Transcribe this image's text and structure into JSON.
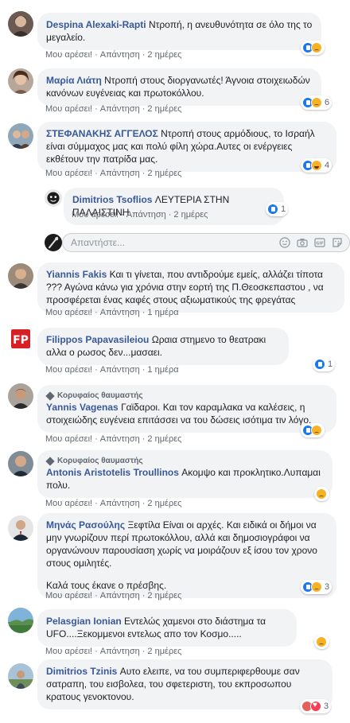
{
  "action_labels": {
    "like": "Μου αρέσει!",
    "reply": "Απάντηση",
    "separator": "·"
  },
  "top_fan_badge": "Κορυφαίος θαυμαστής",
  "reply_box": {
    "placeholder": "Απαντήστε..."
  },
  "comments": [
    {
      "author": "Despina Alexaki-Rapti",
      "text": "Ντροπή, η ανευθυνότητα σε όλο της το μεγαλείο.",
      "time": "2 ημέρες",
      "reactions": [
        "like",
        "sad"
      ],
      "count": ""
    },
    {
      "author": "Μαρία Λιάτη",
      "text": "Ντροπή στους διοργανωτές! Άγνοια στοιχειωδών κανόνων ευγένειας και πρωτοκόλλου.",
      "time": "2 ημέρες",
      "reactions": [
        "like",
        "sad"
      ],
      "count": "6"
    },
    {
      "author": "ΣΤΕΦΑΝΑΚΗΣ ΑΓΓΕΛΟΣ",
      "text": "Ντροπή στους αρμόδιους, το Ισραήλ είναι σύμμαχος μας και πολύ φίλη χώρα.Αυτες οι ενέργειες εκθέτουν την πατρίδα μας.",
      "time": "2 ημέρες",
      "reactions": [
        "like",
        "haha"
      ],
      "count": "4"
    },
    {
      "author": "Dimitrios Tsoflios",
      "text": "ΛΕΥΤΕΡΙΑ ΣΤΗΝ ΠΑΛΑΙΣΤΙΝΗ",
      "time": "2 ημέρες",
      "reactions": [
        "like"
      ],
      "count": "1"
    },
    {
      "author": "Yiannis Fakis",
      "text": "Και τι γίνεται, που αντιδρούμε εμείς, αλλάζει τίποτα ??? Αγώνα κάνω για χρόνια στην εορτή της Π.Θεοσκεπαστου , να προσφέρεται ένας καφές στους αξιωματικούς της φρεγάτας",
      "time": "1 ημέρα",
      "reactions": [],
      "count": ""
    },
    {
      "author": "Filippos Papavasileiou",
      "text": "Ωραια στημενο το θεατρακι αλλα ο ρωσος δεν...μασαει.",
      "time": "1 ημέρα",
      "reactions": [
        "like"
      ],
      "count": "1"
    },
    {
      "author": "Yannis Vagenas",
      "text": "Γαϊδαροι. Και τον καραμλακα να καλέσεις, η στοιχειώδης ευγένεια επιτάσσει να του δώσεις ισότιμα τιν λόγο.",
      "time": "2 ημέρες",
      "reactions": [
        "like",
        "sad"
      ],
      "count": ""
    },
    {
      "author": "Antonis Aristotelis Troullinos",
      "text": "Ακομψο και προκλητικο.Λυπαμαι πολυ.",
      "time": "2 ημέρες",
      "reactions": [
        "sad"
      ],
      "count": ""
    },
    {
      "author": "Μηνάς Ρασούλης",
      "text": "Ξεφτίλα Είναι οι αρχές. Και ειδικά οι δήμοι να μην γνωρίζουν περί πρωτοκόλλου, αλλά και δημοσιογράφοι να οργανώνουν παρουσίαση χωρίς να μοιράζουν εξ ίσου τον χρονο στους ομιλητές.",
      "text2": "Καλά τους έκανε ο πρέσβης.",
      "time": "2 ημέρες",
      "reactions": [
        "like",
        "sad"
      ],
      "count": "3"
    },
    {
      "author": "Pelasgian Ionian",
      "text": "Εντελώς χαμενοι στο διάστημα τα UFO....Ξεκομμενοι εντελως απο τον Κοσμο.....",
      "time": "2 ημέρες",
      "reactions": [
        "sad"
      ],
      "count": ""
    },
    {
      "author": "Dimitrios Tzinis",
      "text": "Αυτο ελειπε, να του συμπεριφερθουμε σαν σατραπη, του εισβολεα, του σφετεριστη, του εκπροσωπου κρατους γενοκτονου.",
      "time": "",
      "reactions": [
        "angry",
        "love"
      ],
      "count": "3"
    }
  ],
  "colors": {
    "author": "#385898",
    "bubble": "#f2f3f5",
    "meta": "#606770",
    "like": "#1877f2",
    "sad": "#f7b125"
  }
}
